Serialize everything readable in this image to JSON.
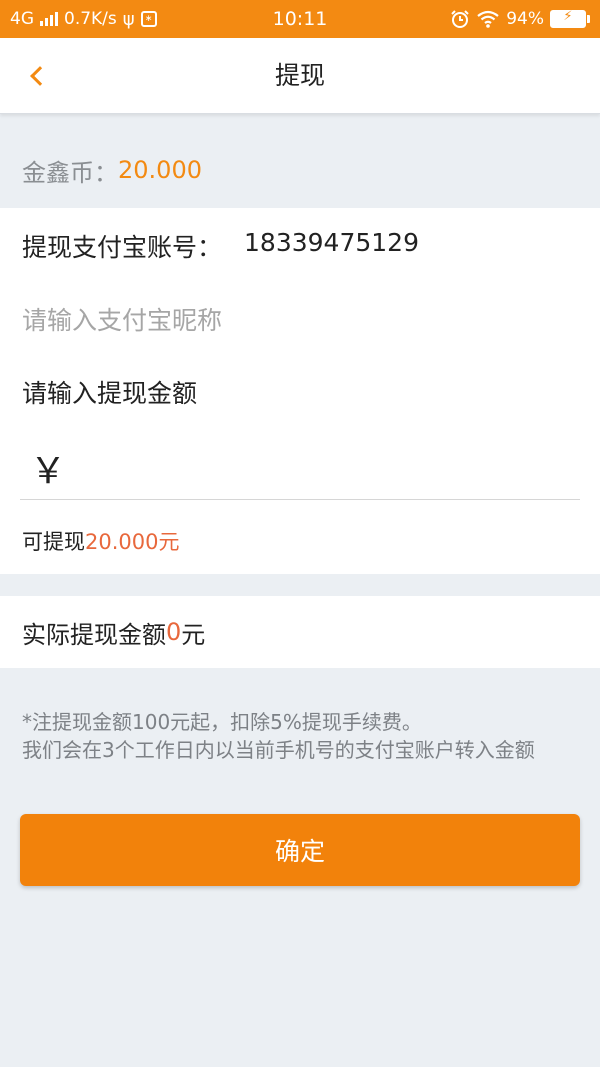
{
  "status_bar": {
    "network": "4G",
    "speed": "0.7K/s",
    "time": "10:11",
    "battery": "94%"
  },
  "nav": {
    "title": "提现"
  },
  "balance": {
    "label": "金鑫币：",
    "value": "20.000"
  },
  "form": {
    "account_label": "提现支付宝账号：",
    "account_value": "18339475129",
    "nickname_placeholder": "请输入支付宝昵称",
    "amount_label": "请输入提现金额",
    "currency_symbol": "￥",
    "available_prefix": "可提现",
    "available_amount": "20.000元"
  },
  "actual": {
    "label": "实际提现金额",
    "amount": "0",
    "unit": "元"
  },
  "notice": {
    "line1": "*注提现金额100元起，扣除5%提现手续费。",
    "line2": "我们会在3个工作日内以当前手机号的支付宝账户转入金额"
  },
  "confirm_label": "确定",
  "icons": {
    "back": "chevron-left-icon",
    "usb": "usb-icon",
    "alarm": "alarm-icon",
    "wifi": "wifi-icon",
    "battery": "battery-icon"
  },
  "colors": {
    "accent": "#f38a12",
    "amount_highlight": "#e8683c",
    "background": "#ebeff3"
  }
}
